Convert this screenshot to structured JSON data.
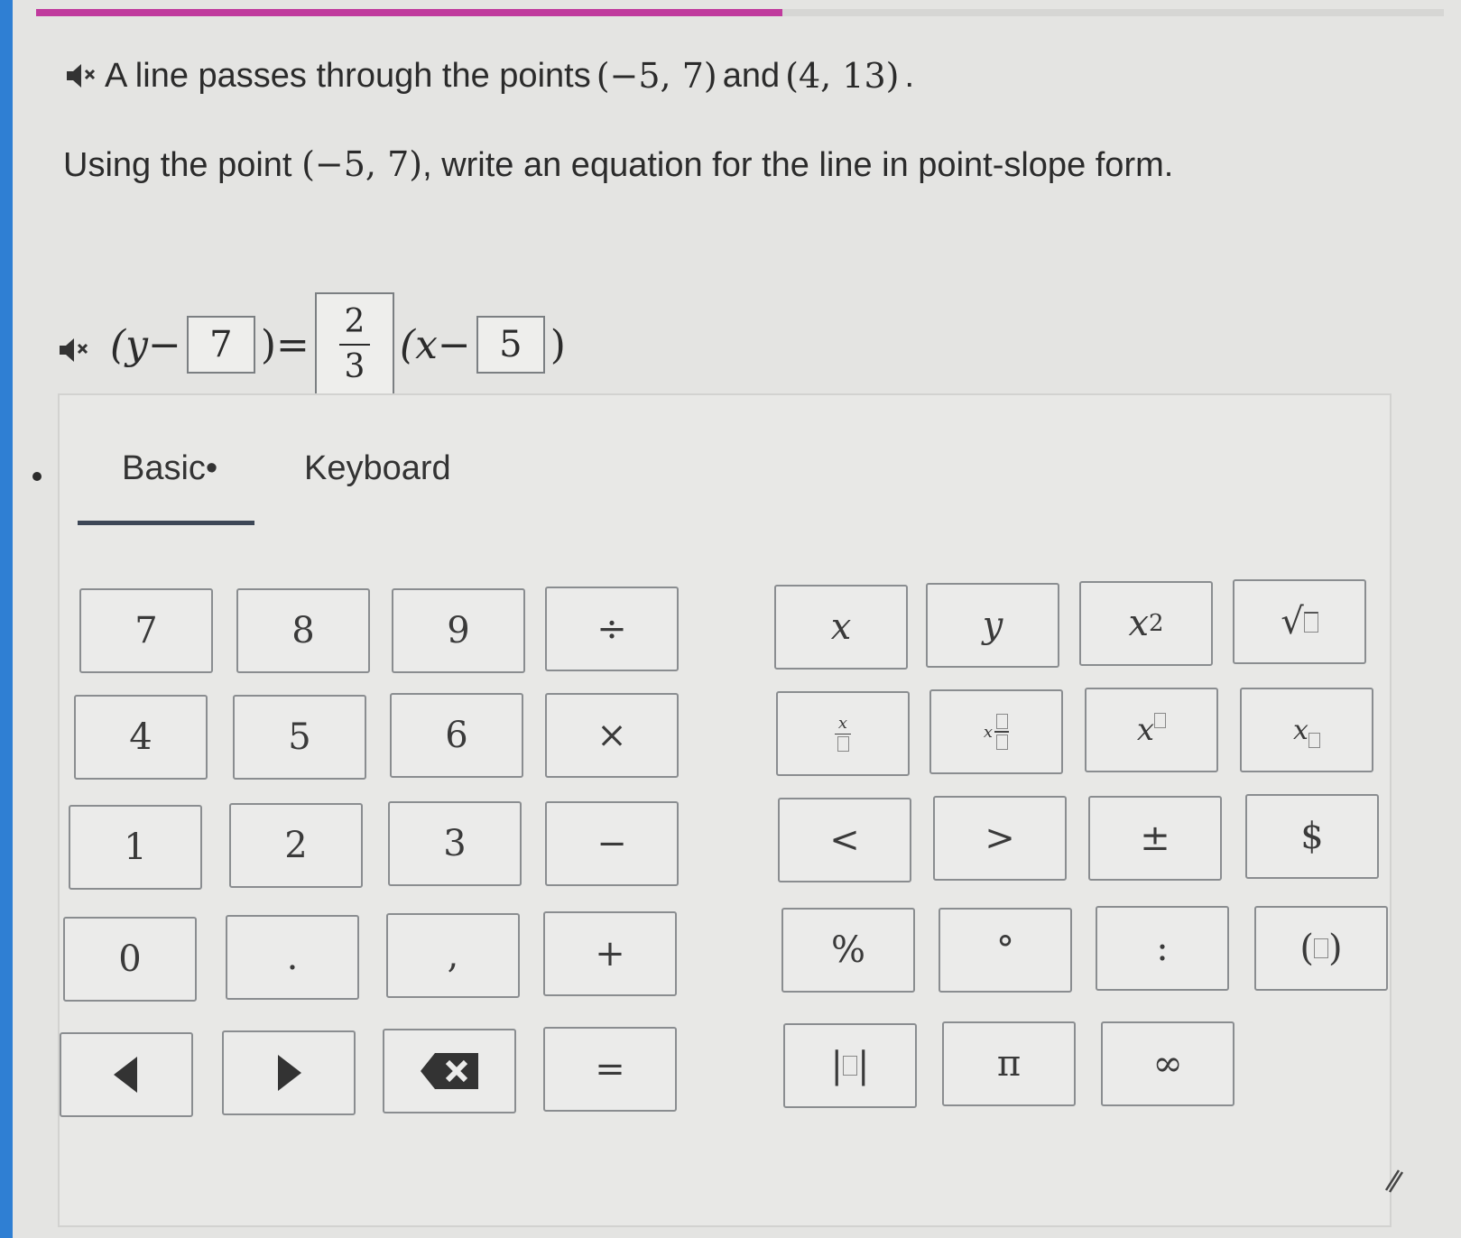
{
  "progress": {
    "fraction": 0.53,
    "fill_color": "#c03a9d"
  },
  "question": {
    "line1_prefix": "A line passes through the points",
    "point1": "(−5, 7)",
    "and_word": "and",
    "point2": "(4, 13)",
    "period": ".",
    "line2_prefix": "Using the point",
    "line2_point": "(−5, 7)",
    "line2_suffix": ", write an equation for the line in point-slope form."
  },
  "equation": {
    "open": "(y−",
    "box1": "7",
    "mid": ")=",
    "slope_num": "2",
    "slope_den": "3",
    "x_part": "(x−",
    "box2": "5",
    "close": ")"
  },
  "tabs": {
    "basic": "Basic",
    "keyboard": "Keyboard",
    "basic_marker": "•"
  },
  "keys": {
    "k7": "7",
    "k8": "8",
    "k9": "9",
    "div": "÷",
    "k4": "4",
    "k5": "5",
    "k6": "6",
    "mul": "×",
    "k1": "1",
    "k2": "2",
    "k3": "3",
    "sub": "−",
    "k0": "0",
    "dot": ".",
    "comma": ",",
    "add": "+",
    "eq": "=",
    "x": "x",
    "y": "y",
    "x_sq_base": "x",
    "x_sq_exp": "2",
    "sqrt": "√",
    "frac_x": "x",
    "mixed_x": "x",
    "pow_x": "x",
    "sub_x": "x",
    "lt": "<",
    "gt": ">",
    "pm": "±",
    "dollar": "$",
    "percent": "%",
    "degree": "°",
    "colon": ":",
    "paren_open": "(",
    "paren_close": ")",
    "abs_open": "|",
    "abs_close": "|",
    "pi": "π",
    "inf": "∞"
  },
  "icons": {
    "speaker": "speaker-mute-icon",
    "left": "arrow-left-icon",
    "right": "arrow-right-icon",
    "backspace": "backspace-icon",
    "pen": "pen-icon"
  }
}
